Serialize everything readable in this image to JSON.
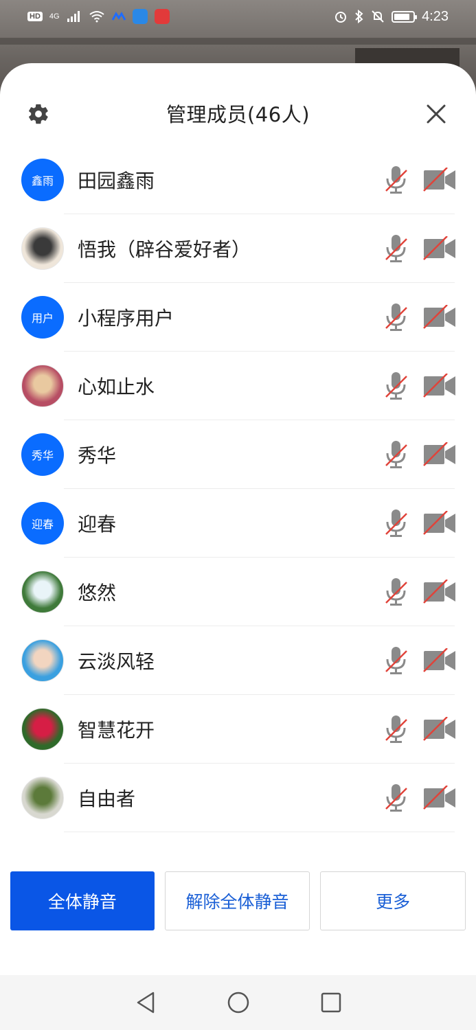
{
  "status_bar": {
    "hd_label": "HD",
    "signal_label": "4G",
    "time": "4:23",
    "battery_percent": 85
  },
  "header": {
    "title": "管理成员(46人)",
    "settings_icon": "gear-icon",
    "close_icon": "close-icon"
  },
  "members": [
    {
      "name": "田园鑫雨",
      "avatar_type": "initials",
      "avatar_text": "鑫雨",
      "mic_muted": true,
      "camera_off": true
    },
    {
      "name": "悟我（辟谷爱好者）",
      "avatar_type": "photo",
      "avatar_text": "",
      "mic_muted": true,
      "camera_off": true
    },
    {
      "name": "小程序用户",
      "avatar_type": "initials",
      "avatar_text": "用户",
      "mic_muted": true,
      "camera_off": true
    },
    {
      "name": "心如止水",
      "avatar_type": "photo",
      "avatar_text": "",
      "mic_muted": true,
      "camera_off": true
    },
    {
      "name": "秀华",
      "avatar_type": "initials",
      "avatar_text": "秀华",
      "mic_muted": true,
      "camera_off": true
    },
    {
      "name": "迎春",
      "avatar_type": "initials",
      "avatar_text": "迎春",
      "mic_muted": true,
      "camera_off": true
    },
    {
      "name": "悠然",
      "avatar_type": "photo",
      "avatar_text": "",
      "mic_muted": true,
      "camera_off": true
    },
    {
      "name": "云淡风轻",
      "avatar_type": "photo",
      "avatar_text": "",
      "mic_muted": true,
      "camera_off": true
    },
    {
      "name": "智慧花开",
      "avatar_type": "photo",
      "avatar_text": "",
      "mic_muted": true,
      "camera_off": true
    },
    {
      "name": "自由者",
      "avatar_type": "photo",
      "avatar_text": "",
      "mic_muted": true,
      "camera_off": true
    }
  ],
  "actions": {
    "mute_all": "全体静音",
    "unmute_all": "解除全体静音",
    "more": "更多"
  },
  "colors": {
    "accent": "#0a56e6",
    "avatar_blue": "#0a6cff",
    "muted_slash": "#e0433a",
    "icon_gray": "#8a8a8a"
  }
}
